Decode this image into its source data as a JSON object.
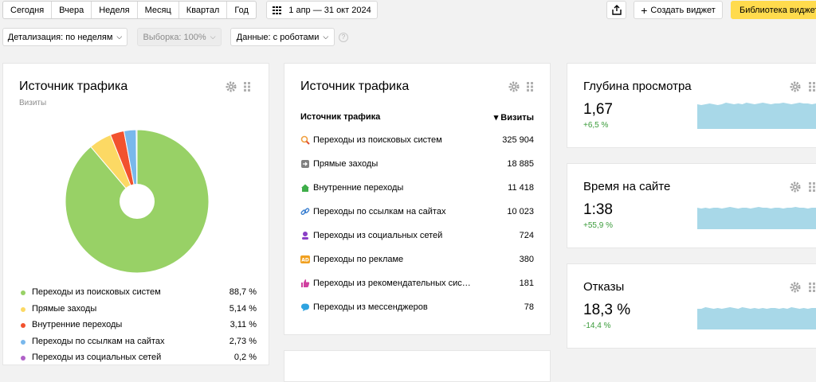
{
  "toolbar": {
    "periods": [
      "Сегодня",
      "Вчера",
      "Неделя",
      "Месяц",
      "Квартал",
      "Год"
    ],
    "date_range": "1 апр — 31 окт 2024",
    "create_widget": "Создать виджет",
    "library_widget": "Библиотека виджет"
  },
  "filters": {
    "detail": "Детализация: по неделям",
    "sample": "Выборка: 100%",
    "data": "Данные: с роботами"
  },
  "pie_card": {
    "title": "Источник трафика",
    "subtitle": "Визиты",
    "legend": [
      {
        "label": "Переходы из поисковых систем",
        "value": "88,7 %",
        "color": "#98d166"
      },
      {
        "label": "Прямые заходы",
        "value": "5,14 %",
        "color": "#fcd964"
      },
      {
        "label": "Внутренние переходы",
        "value": "3,11 %",
        "color": "#f2522e"
      },
      {
        "label": "Переходы по ссылкам на сайтах",
        "value": "2,73 %",
        "color": "#79b8ec"
      },
      {
        "label": "Переходы из социальных сетей",
        "value": "0,2 %",
        "color": "#b061c8"
      }
    ]
  },
  "table_card": {
    "title": "Источник трафика",
    "col_source": "Источник трафика",
    "col_visits": "▾ Визиты",
    "rows": [
      {
        "label": "Переходы из поисковых систем",
        "value": "325 904",
        "icon": "search-icon"
      },
      {
        "label": "Прямые заходы",
        "value": "18 885",
        "icon": "direct-enter-icon"
      },
      {
        "label": "Внутренние переходы",
        "value": "11 418",
        "icon": "home-icon"
      },
      {
        "label": "Переходы по ссылкам на сайтах",
        "value": "10 023",
        "icon": "link-icon"
      },
      {
        "label": "Переходы из социальных сетей",
        "value": "724",
        "icon": "social-user-icon"
      },
      {
        "label": "Переходы по рекламе",
        "value": "380",
        "icon": "ad-icon"
      },
      {
        "label": "Переходы из рекомендательных сис…",
        "value": "181",
        "icon": "thumbs-up-icon"
      },
      {
        "label": "Переходы из мессенджеров",
        "value": "78",
        "icon": "chat-icon"
      }
    ]
  },
  "metrics": [
    {
      "title": "Глубина просмотра",
      "value": "1,67",
      "delta": "+6,5 %"
    },
    {
      "title": "Время на сайте",
      "value": "1:38",
      "delta": "+55,9 %"
    },
    {
      "title": "Отказы",
      "value": "18,3 %",
      "delta": "-14,4 %"
    }
  ],
  "colors": {
    "accent_yellow": "#ffdb4d",
    "sparkline": "#a8d8e8",
    "positive": "#3a9b3a"
  }
}
